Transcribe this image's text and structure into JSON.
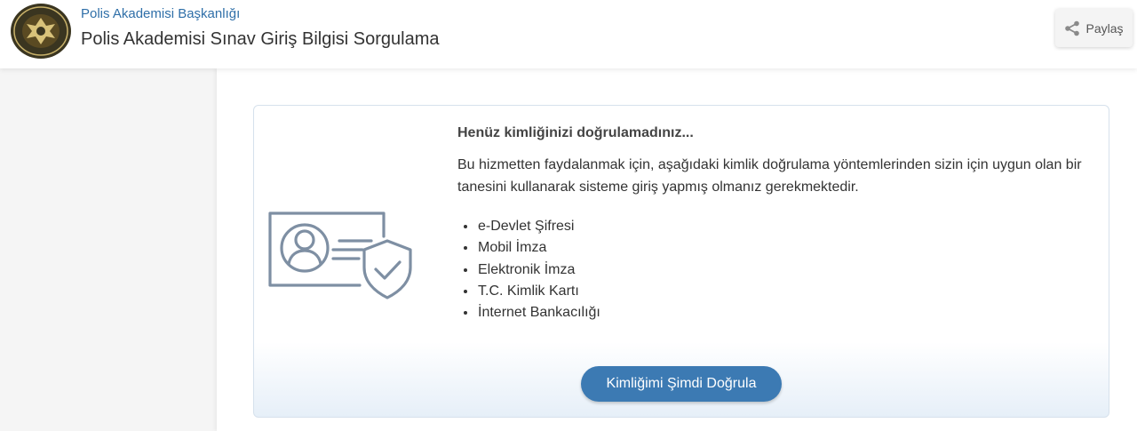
{
  "header": {
    "org_name": "Polis Akademisi Başkanlığı",
    "title": "Polis Akademisi Sınav Giriş Bilgisi Sorgulama",
    "share_label": "Paylaş",
    "logo_icon": "police-academy-seal-icon",
    "share_icon": "share-icon"
  },
  "notice": {
    "title": "Henüz kimliğinizi doğrulamadınız...",
    "description": "Bu hizmetten faydalanmak için, aşağıdaki kimlik doğrulama yöntemlerinden sizin için uygun olan bir tanesini kullanarak sisteme giriş yapmış olmanız gerekmektedir.",
    "methods": [
      "e-Devlet Şifresi",
      "Mobil İmza",
      "Elektronik İmza",
      "T.C. Kimlik Kartı",
      "İnternet Bankacılığı"
    ],
    "button_label": "Kimliğimi Şimdi Doğrula",
    "illustration_icon": "id-card-shield-icon"
  },
  "colors": {
    "accent": "#3c7ab3",
    "link": "#2f6fa8",
    "illustration": "#7e8fa3"
  }
}
